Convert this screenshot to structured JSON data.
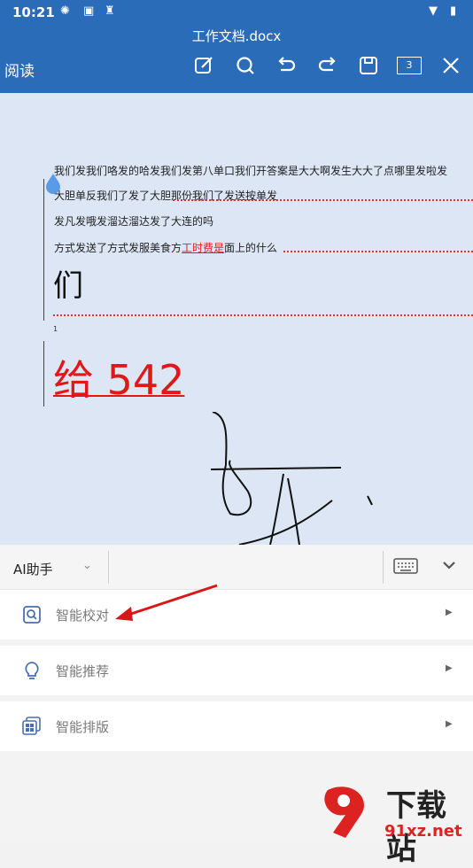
{
  "status_bar": {
    "time": "10:21"
  },
  "header": {
    "doc_title": "工作文档.docx",
    "mode_label": "阅读",
    "page_count": "3"
  },
  "document": {
    "lines": [
      "我们发我们咯发的哈发我们发第八单口我们开答案是大大啊发生大大了点哪里发啦发",
      "大胆单反我们了发了大胆那份我们了发送按单发",
      "发凡发哦发溜达溜达发了大连的吗"
    ],
    "line4_prefix": "方式发送了方式发服美食方",
    "line4_red": "工时费是",
    "line4_suffix": "面上的什么",
    "big_char": "们",
    "footnote_mark": "1",
    "big_text": "给 542"
  },
  "assistant": {
    "ai_label": "AI助手",
    "items": [
      {
        "label": "智能校对"
      },
      {
        "label": "智能推荐"
      },
      {
        "label": "智能排版"
      }
    ]
  },
  "watermark": {
    "text": "下载站",
    "site": "91xz.net"
  },
  "colors": {
    "brand": "#2b6cb8",
    "doc_bg": "#dce6f4",
    "highlight_red": "#e01818"
  }
}
